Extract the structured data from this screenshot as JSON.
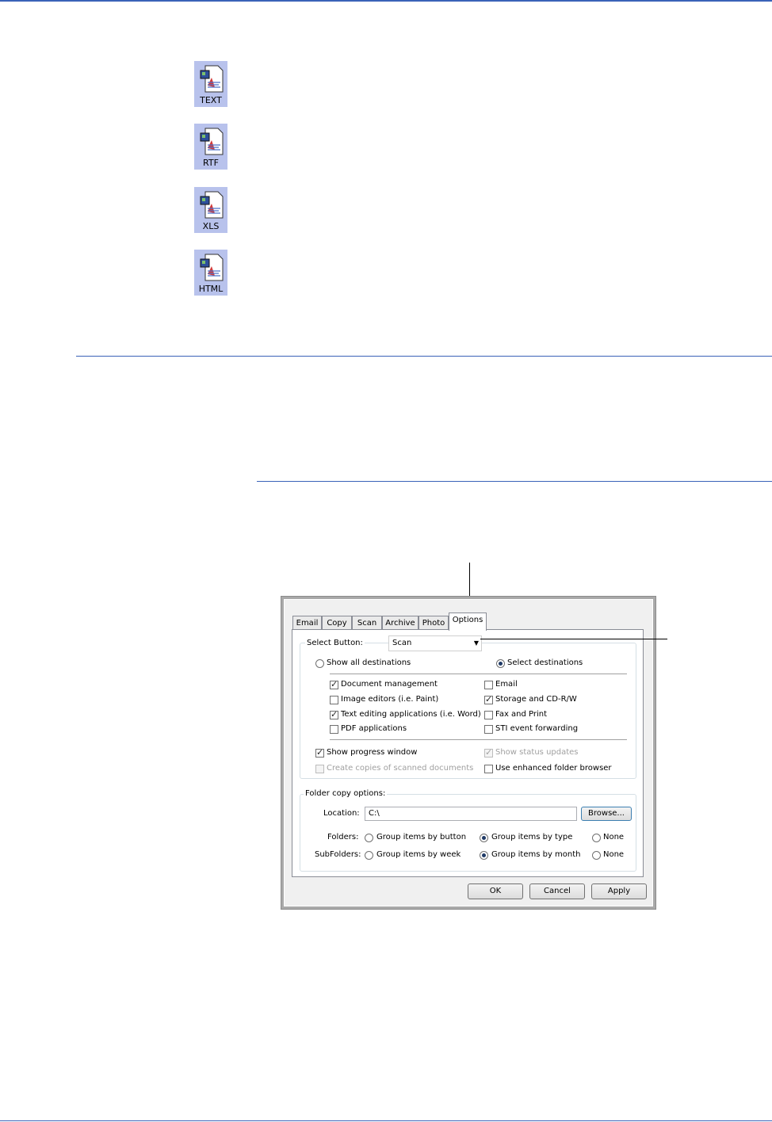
{
  "format_icons": [
    {
      "label": "TEXT",
      "icon": "text-document-icon"
    },
    {
      "label": "RTF",
      "icon": "rtf-document-icon"
    },
    {
      "label": "XLS",
      "icon": "xls-document-icon"
    },
    {
      "label": "HTML",
      "icon": "html-document-icon"
    }
  ],
  "colors": {
    "rule": "#3a62b8",
    "icon_bg": "#b8c2ec"
  },
  "dialog": {
    "tabs": [
      "Email",
      "Copy",
      "Scan",
      "Archive",
      "Photo",
      "Options"
    ],
    "active_tab": "Options",
    "select_button": {
      "label": "Select Button:",
      "value": "Scan"
    },
    "destinations": {
      "show_all": {
        "label": "Show all destinations",
        "selected": false
      },
      "select": {
        "label": "Select destinations",
        "selected": true
      }
    },
    "categories": [
      {
        "label": "Document management",
        "checked": true
      },
      {
        "label": "Email",
        "checked": false
      },
      {
        "label": "Image editors (i.e. Paint)",
        "checked": false
      },
      {
        "label": "Storage and CD-R/W",
        "checked": true
      },
      {
        "label": "Text editing applications (i.e. Word)",
        "checked": true
      },
      {
        "label": "Fax and Print",
        "checked": false
      },
      {
        "label": "PDF applications",
        "checked": false
      },
      {
        "label": "STI event forwarding",
        "checked": false
      }
    ],
    "options": [
      {
        "label": "Show progress window",
        "checked": true,
        "disabled": false
      },
      {
        "label": "Show status updates",
        "checked": true,
        "disabled": true
      },
      {
        "label": "Create copies of scanned documents",
        "checked": false,
        "disabled": true
      },
      {
        "label": "Use enhanced folder browser",
        "checked": false,
        "disabled": false
      }
    ],
    "folder_copy": {
      "title": "Folder copy options:",
      "location_label": "Location:",
      "location_value": "C:\\",
      "browse_label": "Browse...",
      "folders_label": "Folders:",
      "folders_options": [
        "Group items by button",
        "Group items by type",
        "None"
      ],
      "folders_selected": "Group items by type",
      "subfolders_label": "SubFolders:",
      "subfolders_options": [
        "Group items by week",
        "Group items by month",
        "None"
      ],
      "subfolders_selected": "Group items by month"
    },
    "buttons": {
      "ok": "OK",
      "cancel": "Cancel",
      "apply": "Apply"
    }
  }
}
